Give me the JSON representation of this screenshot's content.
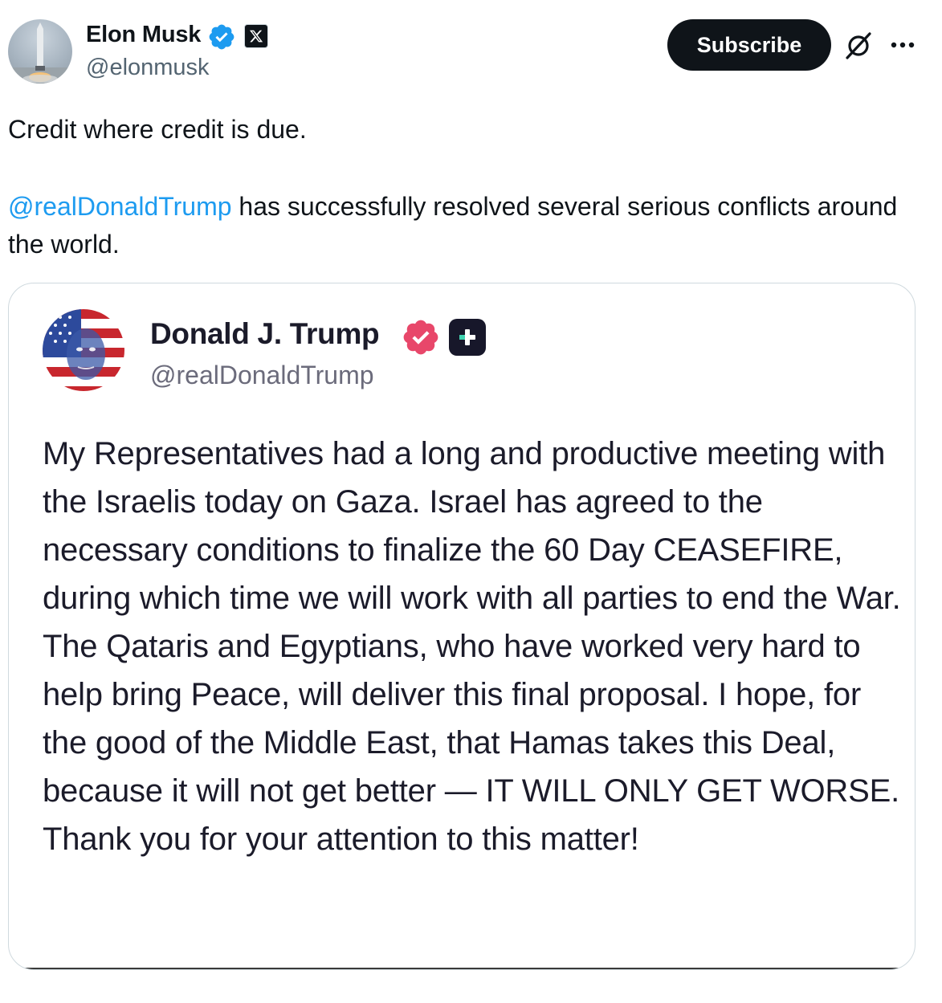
{
  "post": {
    "author": {
      "name": "Elon Musk",
      "handle": "@elonmusk",
      "verified": true,
      "avatar_icon": "rocket-launch-avatar",
      "affiliate_icon": "x-logo-icon"
    },
    "actions": {
      "subscribe_label": "Subscribe",
      "grok_icon": "grok-icon",
      "more_icon": "more-icon"
    },
    "text": {
      "line1": "Credit where credit is due.",
      "mention": "@realDonaldTrump",
      "line2_rest": " has successfully resolved several serious conflicts around the world."
    },
    "colors": {
      "link": "#1d9bf0",
      "verified": "#1d9bf0",
      "button_bg": "#0f1419",
      "secondary_text": "#536471"
    }
  },
  "embedded": {
    "author_name": "Donald J. Trump",
    "author_handle": "@realDonaldTrump",
    "avatar_icon": "flag-portrait-avatar",
    "badge_icon": "truth-verified-badge-icon",
    "plus_icon": "truth-plus-icon",
    "badge_color": "#e8476a",
    "body": "My Representatives had a long and productive meeting with the Israelis today on Gaza. Israel has agreed to the necessary conditions to finalize the 60 Day CEASEFIRE, during which time we will work with all parties to end the War. The Qataris and Egyptians, who have worked very hard to help bring Peace, will deliver this final proposal. I hope, for the good of the Middle East, that Hamas takes this Deal, because it will not get better — IT WILL ONLY GET WORSE. Thank you for your attention to this matter!"
  }
}
